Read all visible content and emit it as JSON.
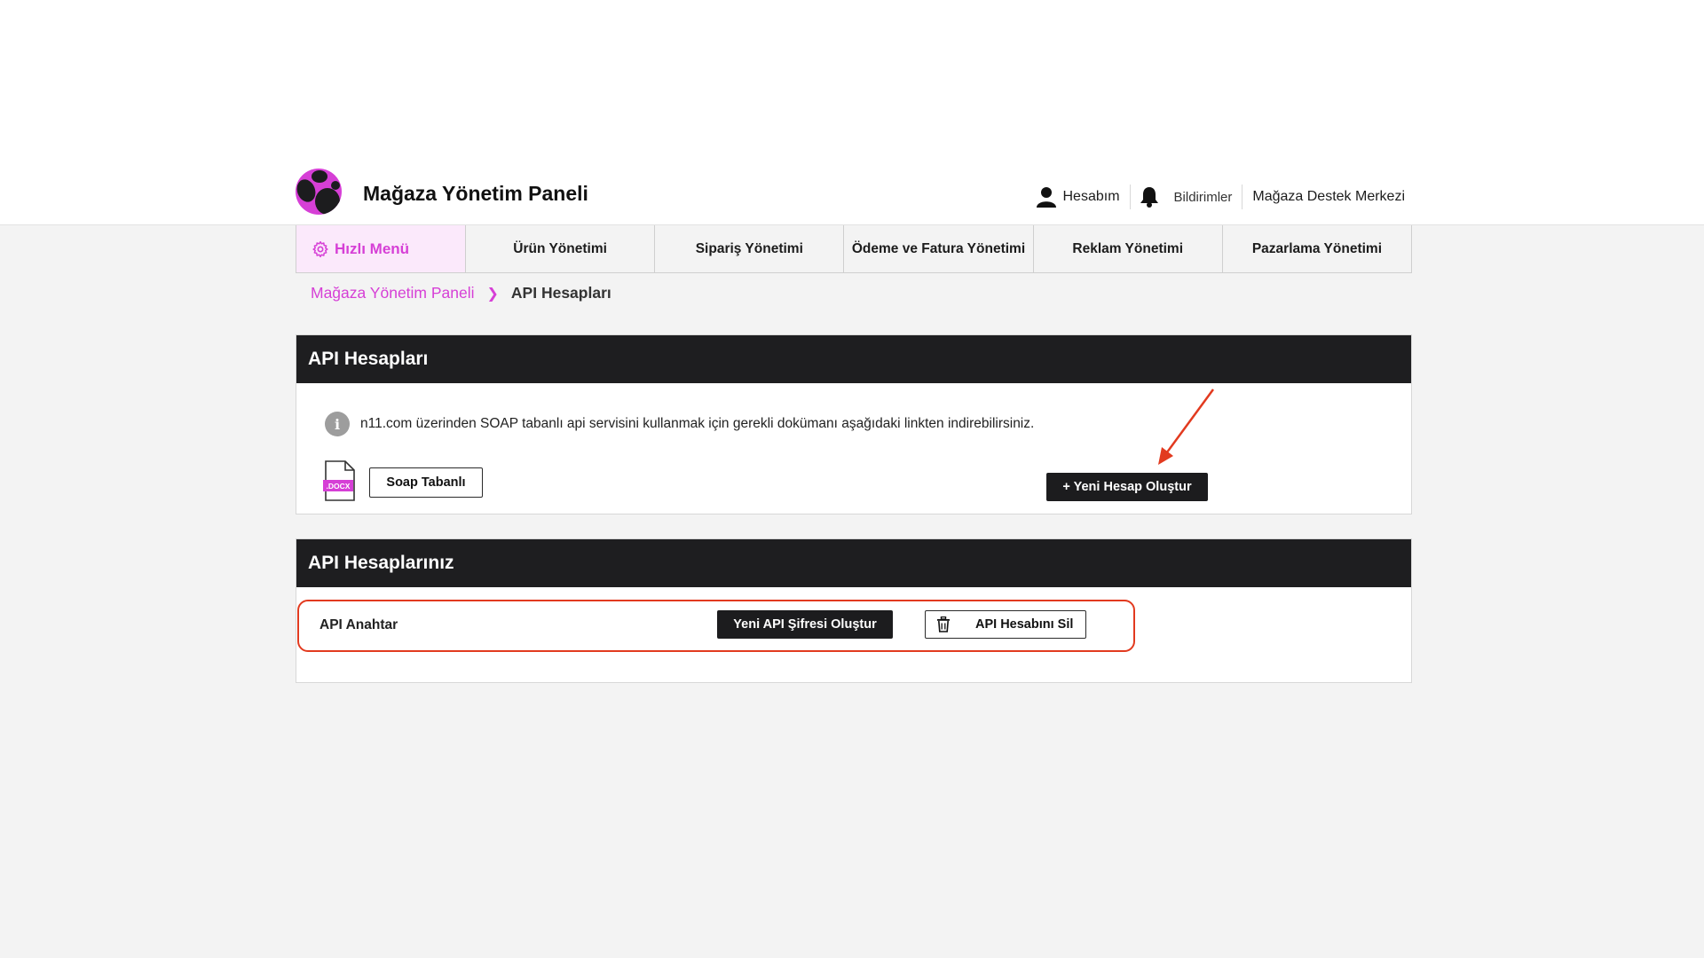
{
  "header": {
    "title": "Mağaza Yönetim Paneli",
    "links": {
      "account": "Hesabım",
      "notifications": "Bildirimler",
      "support": "Mağaza Destek Merkezi"
    }
  },
  "nav": {
    "quick_menu": "Hızlı Menü",
    "items": [
      "Ürün Yönetimi",
      "Sipariş Yönetimi",
      "Ödeme ve Fatura Yönetimi",
      "Reklam Yönetimi",
      "Pazarlama Yönetimi"
    ]
  },
  "breadcrumb": {
    "home": "Mağaza Yönetim Paneli",
    "current": "API Hesapları"
  },
  "api_accounts": {
    "title": "API Hesapları",
    "info_text": "n11.com üzerinden SOAP tabanlı api servisini kullanmak için gerekli dokümanı aşağıdaki linkten indirebilirsiniz.",
    "doc_badge": ".DOCX",
    "soap_button": "Soap Tabanlı",
    "new_account_button": "+ Yeni Hesap Oluştur"
  },
  "your_accounts": {
    "title": "API Hesaplarınız",
    "row_label": "API Anahtar",
    "new_password_button": "Yeni API Şifresi Oluştur",
    "delete_button": "API Hesabını Sil"
  },
  "colors": {
    "brand": "#d63fd6",
    "dark": "#1e1e20",
    "annotation": "#e23a1f"
  }
}
